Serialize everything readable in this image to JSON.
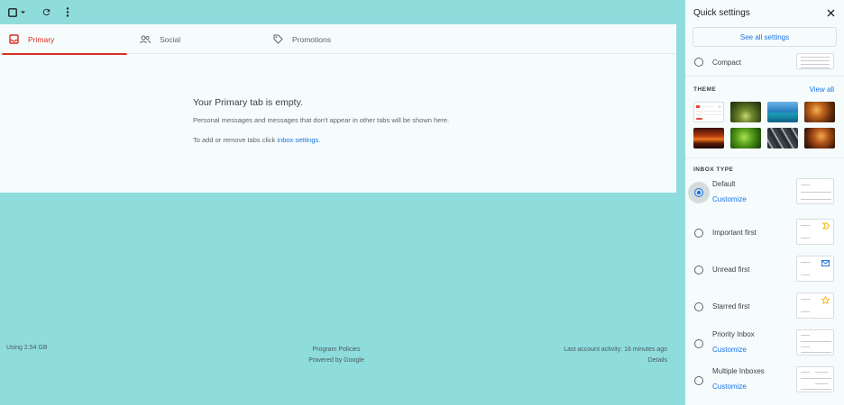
{
  "toolbar": {
    "icons": [
      "select-checkbox-icon",
      "select-dropdown-icon",
      "refresh-icon",
      "more-vert-icon"
    ]
  },
  "tabs": [
    {
      "label": "Primary",
      "icon": "inbox-icon",
      "active": true
    },
    {
      "label": "Social",
      "icon": "people-icon",
      "active": false
    },
    {
      "label": "Promotions",
      "icon": "tag-icon",
      "active": false
    }
  ],
  "empty": {
    "title": "Your Primary tab is empty.",
    "line1": "Personal messages and messages that don't appear in other tabs will be shown here.",
    "line2_prefix": "To add or remove tabs click ",
    "line2_link": "inbox settings",
    "line2_suffix": "."
  },
  "footer": {
    "storage": "Using 2.54 GB",
    "program_policies": "Program Policies",
    "powered_by": "Powered by Google",
    "last_activity": "Last account activity: 16 minutes ago",
    "details": "Details"
  },
  "quick_settings": {
    "title": "Quick settings",
    "see_all": "See all settings",
    "density_option": "Compact",
    "theme_label": "THEME",
    "view_all": "View all",
    "inbox_type_label": "INBOX TYPE",
    "inbox_types": [
      {
        "label": "Default",
        "link": "Customize",
        "selected": true,
        "thumb_icon": ""
      },
      {
        "label": "Important first",
        "link": "",
        "selected": false,
        "thumb_icon": "important-marker-icon"
      },
      {
        "label": "Unread first",
        "link": "",
        "selected": false,
        "thumb_icon": "envelope-icon"
      },
      {
        "label": "Starred first",
        "link": "",
        "selected": false,
        "thumb_icon": "star-icon"
      },
      {
        "label": "Priority Inbox",
        "link": "Customize",
        "selected": false,
        "thumb_icon": ""
      },
      {
        "label": "Multiple Inboxes",
        "link": "Customize",
        "selected": false,
        "thumb_icon": ""
      }
    ],
    "themes": [
      "default-theme",
      "forest-theme",
      "ocean-theme",
      "autumn-leaves-theme",
      "sunset-theme",
      "green-leaf-theme",
      "pebbles-theme",
      "autumn-forest-theme"
    ]
  },
  "colors": {
    "background": "#8fdcdd",
    "panel": "#f6fcfc",
    "accent_red": "#d93025",
    "link_blue": "#1a73e8"
  }
}
